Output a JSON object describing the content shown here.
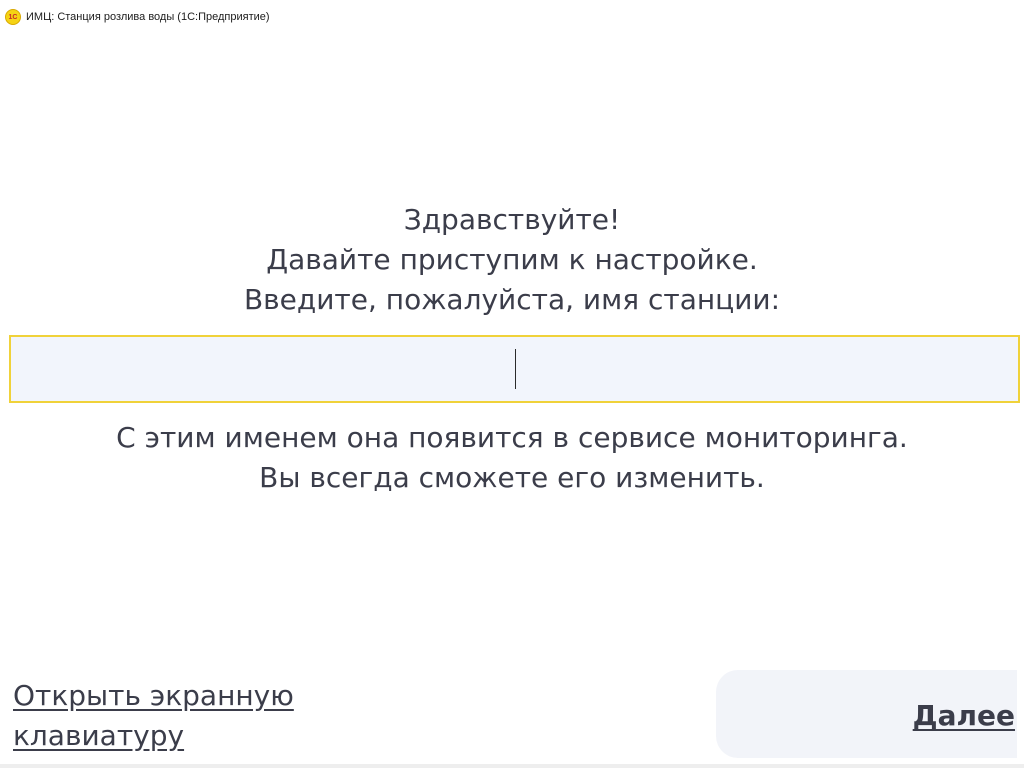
{
  "window": {
    "logo_text": "1C",
    "title": "ИМЦ: Станция розлива воды  (1С:Предприятие)"
  },
  "greeting": {
    "line1": "Здравствуйте!",
    "line2": "Давайте приступим к настройке.",
    "line3": "Введите, пожалуйста, имя станции:"
  },
  "station_name_input": {
    "value": "",
    "placeholder": ""
  },
  "hint": {
    "line1": "С этим именем она появится в сервисе мониторинга.",
    "line2": "Вы всегда сможете его изменить."
  },
  "footer": {
    "keyboard_link_line1": "Открыть экранную",
    "keyboard_link_line2": "клавиатуру",
    "next_label": "Далее"
  },
  "colors": {
    "accent_border": "#f0d23a",
    "input_background": "#f2f5fc",
    "text": "#3b3d4a",
    "panel_background": "#f2f4f9"
  },
  "icons": {
    "app_logo": "1c-logo-icon"
  }
}
